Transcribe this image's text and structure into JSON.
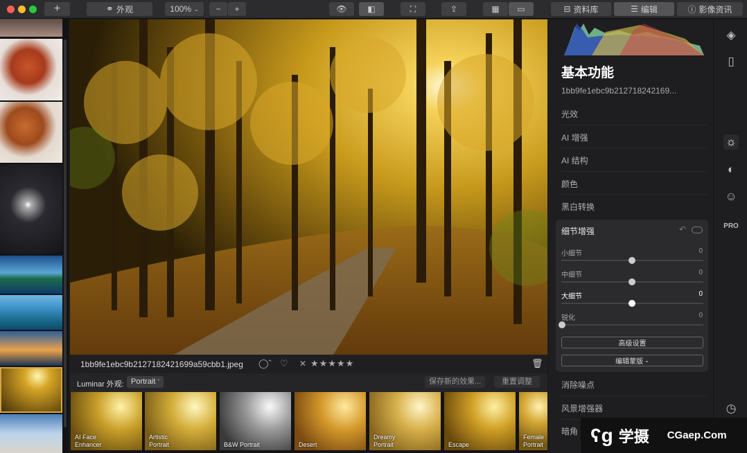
{
  "toolbar": {
    "add_icon": "plus-icon",
    "looks_label": "外观",
    "zoom": "100%",
    "zoom_out": "−",
    "zoom_in": "+",
    "tab_library": "资料库",
    "tab_edit": "编辑",
    "tab_info": "影像资讯"
  },
  "photo": {
    "filename": "1bb9fe1ebc9b2127182421699a59cbb1.jpeg",
    "rating_reject": "✕",
    "stars": "★★★★★"
  },
  "looks_bar": {
    "label": "Luminar 外观:",
    "category": "Portrait",
    "save_looks": "保存新的效果...",
    "reset": "重置调整"
  },
  "looks": [
    {
      "line1": "AI Face",
      "line2": "Enhancer"
    },
    {
      "line1": "Artistic",
      "line2": "Portrait"
    },
    {
      "line1": "",
      "line2": "B&W Portrait"
    },
    {
      "line1": "",
      "line2": "Desert"
    },
    {
      "line1": "Dreamy",
      "line2": "Portrait"
    },
    {
      "line1": "",
      "line2": "Escape"
    },
    {
      "line1": "Female",
      "line2": "Portrait"
    }
  ],
  "panel": {
    "title": "基本功能",
    "file_id": "1bb9fe1ebc9b212718242169...",
    "sections": [
      "光效",
      "AI 增强",
      "AI 结构",
      "颜色",
      "黑白转换"
    ],
    "detail": {
      "title": "细节增强",
      "sliders": [
        {
          "label": "小细节",
          "value": "0"
        },
        {
          "label": "中细节",
          "value": "0"
        },
        {
          "label": "大细节",
          "value": "0"
        },
        {
          "label": "锐化",
          "value": "0"
        }
      ],
      "advanced": "高级设置",
      "mask": "编辑蒙版"
    },
    "more_sections": [
      "消除噪点",
      "风景增强器",
      "暗角"
    ]
  },
  "sidebar": {
    "pro": "PRO"
  },
  "watermark": {
    "brand": "学摄",
    "site": "CGaep.Com"
  },
  "colors": {
    "accent": "#d9a441",
    "panel_bg": "#1e1e20"
  }
}
